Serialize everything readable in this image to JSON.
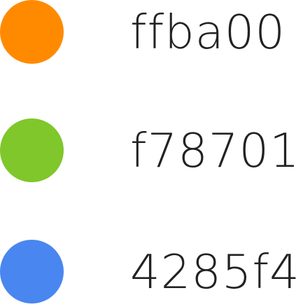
{
  "swatches": [
    {
      "label": "ffba00",
      "color": "#FF8A00"
    },
    {
      "label": "f78701",
      "color": "#7FC72A"
    },
    {
      "label": "4285f4",
      "color": "#4A86F0"
    }
  ]
}
